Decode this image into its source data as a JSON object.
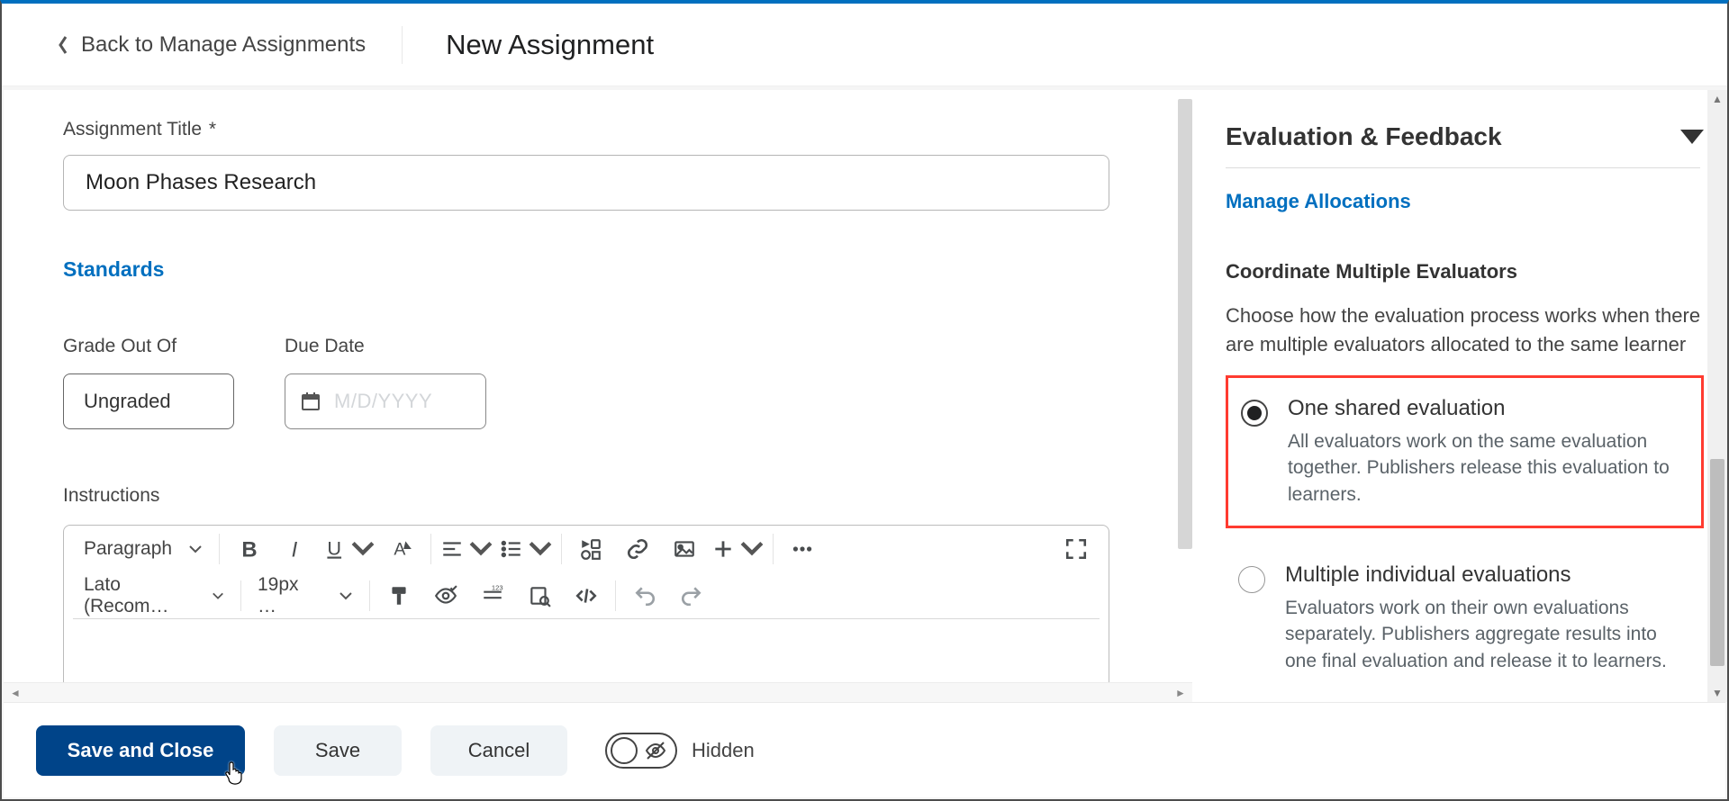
{
  "header": {
    "back_label": "Back to Manage Assignments",
    "page_title": "New Assignment"
  },
  "form": {
    "title_label": "Assignment Title",
    "title_required_marker": "*",
    "title_value": "Moon Phases Research",
    "standards_link": "Standards",
    "grade_label": "Grade Out Of",
    "grade_value": "Ungraded",
    "due_label": "Due Date",
    "due_placeholder": "M/D/YYYY",
    "instructions_label": "Instructions"
  },
  "editor": {
    "block_format": "Paragraph",
    "font_family": "Lato (Recom…",
    "font_size": "19px …"
  },
  "side_panel": {
    "title": "Evaluation & Feedback",
    "manage_link": "Manage Allocations",
    "section_heading": "Coordinate Multiple Evaluators",
    "section_desc": "Choose how the evaluation process works when there are multiple evaluators allocated to the same learner",
    "options": [
      {
        "title": "One shared evaluation",
        "desc": "All evaluators work on the same evaluation together. Publishers release this evaluation to learners.",
        "selected": true,
        "highlight": true
      },
      {
        "title": "Multiple individual evaluations",
        "desc": "Evaluators work on their own evaluations separately. Publishers aggregate results into one final evaluation and release it to learners.",
        "selected": false,
        "highlight": false
      }
    ]
  },
  "footer": {
    "save_close": "Save and Close",
    "save": "Save",
    "cancel": "Cancel",
    "visibility_label": "Hidden"
  }
}
